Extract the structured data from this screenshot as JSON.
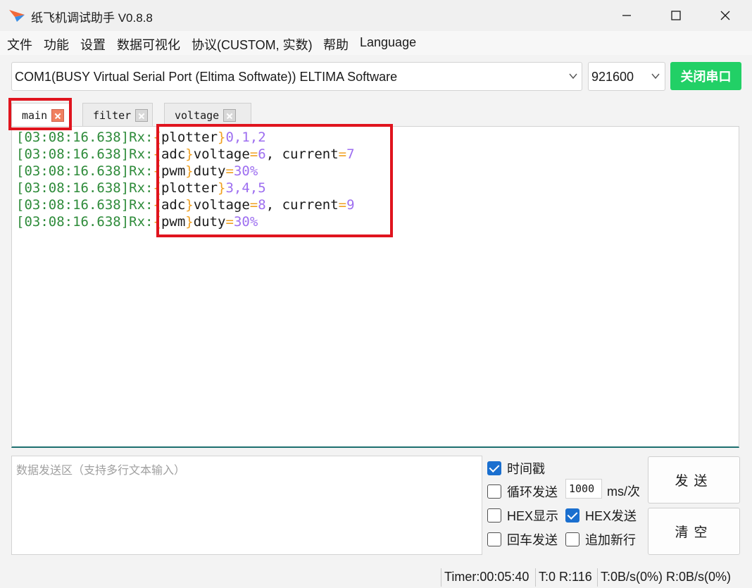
{
  "window": {
    "title": "纸飞机调试助手 V0.8.8",
    "minimize": "—",
    "maximize": "☐",
    "close": "✕"
  },
  "menu": [
    "文件",
    "功能",
    "设置",
    "数据可视化",
    "协议(CUSTOM, 实数)",
    "帮助",
    "Language"
  ],
  "toolbar": {
    "port": "COM1(BUSY  Virtual Serial Port (Eltima Softwate)) ELTIMA Software",
    "baud": "921600",
    "close_port_label": "关闭串口"
  },
  "tabs": [
    {
      "label": "main",
      "active": true
    },
    {
      "label": "filter",
      "active": false
    },
    {
      "label": "voltage",
      "active": false
    }
  ],
  "log": [
    {
      "ts": "[03:08:16.638]",
      "dir": "Rx:",
      "tag": "plotter",
      "body": "0,1,2"
    },
    {
      "ts": "[03:08:16.638]",
      "dir": "Rx:",
      "tag": "adc",
      "body": "voltage=6, current=7"
    },
    {
      "ts": "[03:08:16.638]",
      "dir": "Rx:",
      "tag": "pwm",
      "body": "duty=30%"
    },
    {
      "ts": "[03:08:16.638]",
      "dir": "Rx:",
      "tag": "plotter",
      "body": "3,4,5"
    },
    {
      "ts": "[03:08:16.638]",
      "dir": "Rx:",
      "tag": "adc",
      "body": "voltage=8, current=9"
    },
    {
      "ts": "[03:08:16.638]",
      "dir": "Rx:",
      "tag": "pwm",
      "body": "duty=30%"
    }
  ],
  "send": {
    "placeholder": "数据发送区（支持多行文本输入）"
  },
  "options": {
    "timestamp": {
      "label": "时间戳",
      "checked": true
    },
    "loop_send": {
      "label": "循环发送",
      "checked": false
    },
    "interval": "1000",
    "interval_unit": "ms/次",
    "hex_display": {
      "label": "HEX显示",
      "checked": false
    },
    "hex_send": {
      "label": "HEX发送",
      "checked": true
    },
    "enter_send": {
      "label": "回车发送",
      "checked": false
    },
    "append_newline": {
      "label": "追加新行",
      "checked": false
    }
  },
  "buttons": {
    "send": "发送",
    "clear": "清空"
  },
  "status": {
    "timer": "Timer:00:05:40",
    "counts": "T:0 R:116",
    "rate": "T:0B/s(0%) R:0B/s(0%)"
  },
  "colors": {
    "accent_green": "#22d066",
    "timestamp_green": "#2e8b3a",
    "bracket_orange": "#f0a020",
    "number_purple": "#9d6ef0",
    "annotation_red": "#e0141e",
    "checkbox_blue": "#1a6fcf"
  }
}
